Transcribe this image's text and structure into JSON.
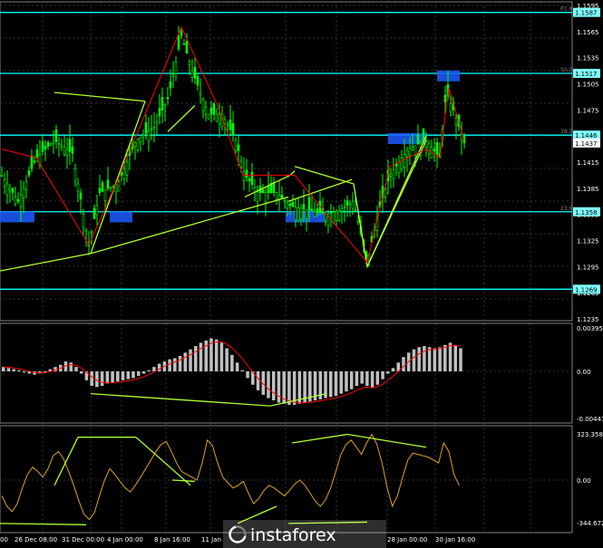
{
  "chart_data": [
    {
      "type": "candlestick",
      "pair_direction": "upper-panel-price",
      "ylim": [
        1.2235,
        1.1595
      ],
      "y_ticks": [
        "1.1595",
        "1.1565",
        "1.1535",
        "1.1505",
        "1.1475",
        "1.1415",
        "1.1385",
        "1.1355",
        "1.1325",
        "1.1295",
        "1.1265",
        "1.1235"
      ],
      "price_tags": [
        {
          "value": "1.1587",
          "color": "#7fffff"
        },
        {
          "value": "1.1517",
          "color": "#7fffff"
        },
        {
          "value": "1.1446",
          "color": "#7fffff"
        },
        {
          "value": "1.1437",
          "color": "#ffffff"
        },
        {
          "value": "1.1358",
          "color": "#7fffff"
        },
        {
          "value": "1.1269",
          "color": "#7fffff"
        }
      ],
      "fib_levels": [
        {
          "label": "61.8",
          "price": 1.1587
        },
        {
          "label": "50.0",
          "price": 1.1517
        },
        {
          "label": "38.2",
          "price": 1.1446
        },
        {
          "label": "23.6",
          "price": 1.1358
        }
      ],
      "support_line": {
        "price": 1.1269
      },
      "close_price": 1.1437,
      "candle_color_up": "#00ff00",
      "candle_color_down": "#00ff00",
      "level_color": "#00ffff",
      "channel_color": "#adff2f",
      "zigzag_color": "#ff0000"
    },
    {
      "type": "bar",
      "indicator": "MACD",
      "ylim": [
        -0.00447,
        0.00395
      ],
      "y_ticks": [
        "0.00395",
        "0.00",
        "-0.00447"
      ],
      "bar_color": "#c0c0c0",
      "signal_color": "#ff0000",
      "values": [
        0.0004,
        0.0003,
        0.0002,
        0.0001,
        -0.0001,
        -0.0002,
        -0.0003,
        -0.0002,
        -0.0001,
        0.0002,
        0.0004,
        0.0006,
        0.0009,
        0.0008,
        0.0004,
        -0.0002,
        -0.0008,
        -0.0013,
        -0.0014,
        -0.0013,
        -0.0011,
        -0.001,
        -0.0009,
        -0.0008,
        -0.0007,
        -0.0006,
        -0.0004,
        -0.0002,
        0.0001,
        0.0004,
        0.0007,
        0.0009,
        0.0011,
        0.0012,
        0.0014,
        0.0017,
        0.002,
        0.0023,
        0.0026,
        0.0028,
        0.003,
        0.0029,
        0.0026,
        0.0021,
        0.0015,
        0.0008,
        0.0001,
        -0.0006,
        -0.0012,
        -0.0017,
        -0.0021,
        -0.0024,
        -0.0026,
        -0.0028,
        -0.0029,
        -0.003,
        -0.003,
        -0.0029,
        -0.0028,
        -0.0027,
        -0.0026,
        -0.0025,
        -0.0024,
        -0.0023,
        -0.0022,
        -0.002,
        -0.0018,
        -0.0016,
        -0.0013,
        -0.0011,
        -0.0013,
        -0.0015,
        -0.0012,
        -0.0007,
        -0.0002,
        0.0003,
        0.0008,
        0.0013,
        0.0017,
        0.002,
        0.0022,
        0.0023,
        0.0022,
        0.0021,
        0.0022,
        0.0024,
        0.0026,
        0.0024,
        0.0021
      ]
    },
    {
      "type": "line",
      "indicator": "CCI",
      "ylim": [
        -344.6721,
        323.3582
      ],
      "y_ticks": [
        "323.3582",
        "0.00",
        "-344.6721"
      ],
      "line_color": "#daa520",
      "values": [
        -120,
        -200,
        -240,
        -180,
        -60,
        40,
        90,
        60,
        20,
        80,
        170,
        200,
        150,
        60,
        -40,
        -160,
        -260,
        -300,
        -250,
        -120,
        0,
        80,
        40,
        -10,
        -60,
        -90,
        -40,
        20,
        80,
        140,
        200,
        250,
        270,
        200,
        120,
        60,
        40,
        20,
        0,
        120,
        280,
        240,
        120,
        20,
        -20,
        -60,
        -40,
        -10,
        -100,
        -180,
        -140,
        -80,
        -40,
        -60,
        -90,
        -120,
        -80,
        -30,
        0,
        -40,
        -100,
        -160,
        -200,
        -150,
        -60,
        60,
        180,
        250,
        280,
        230,
        180,
        260,
        320,
        250,
        120,
        -60,
        -200,
        -120,
        20,
        140,
        190,
        180,
        170,
        160,
        140,
        120,
        260,
        200,
        40,
        -40
      ]
    }
  ],
  "x_labels": [
    "00",
    "26 Dec 08:00",
    "31 Dec 00:00",
    "4 Jan 00:00",
    "8 Jan 16:00",
    "11 Jan",
    "28 Jan 00:00",
    "30 Jan 16:00"
  ],
  "watermark": "instaforex"
}
